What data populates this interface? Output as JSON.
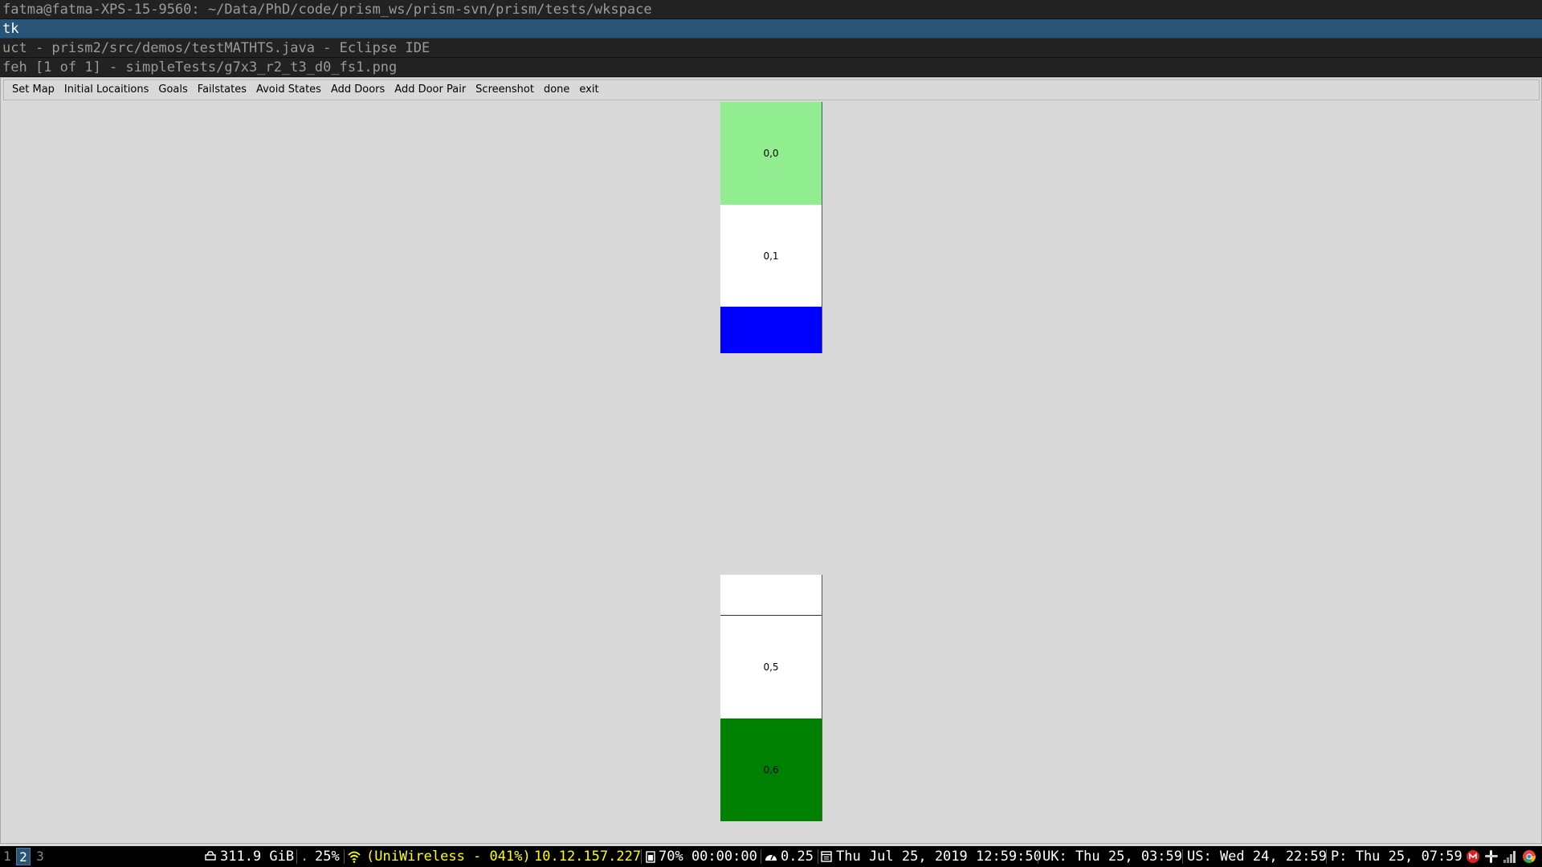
{
  "windows": {
    "title1": "fatma@fatma-XPS-15-9560: ~/Data/PhD/code/prism_ws/prism-svn/prism/tests/wkspace",
    "title2": "tk",
    "title3": "uct - prism2/src/demos/testMATHTS.java - Eclipse IDE",
    "title4": "feh [1 of 1] - simpleTests/g7x3_r2_t3_d0_fs1.png"
  },
  "menu": {
    "set_map": "Set Map",
    "initial_locations": "Initial Locaitions",
    "goals": "Goals",
    "failstates": "Failstates",
    "avoid_states": "Avoid States",
    "add_doors": "Add Doors",
    "add_door_pair": "Add Door Pair",
    "screenshot": "Screenshot",
    "done": "done",
    "exit": "exit"
  },
  "grid": {
    "cells": [
      {
        "label": "0,0",
        "color": "#90ee90"
      },
      {
        "label": "0,1",
        "color": "#ffffff"
      },
      {
        "label": "",
        "color": "#0000ff"
      },
      {
        "label": "",
        "color": "#ffffff"
      },
      {
        "label": "0,5",
        "color": "#ffffff"
      },
      {
        "label": "0,6",
        "color": "#008000"
      }
    ]
  },
  "statusbar": {
    "workspaces": [
      "1",
      "2",
      "3"
    ],
    "active_workspace": "2",
    "disk": "311.9 GiB",
    "volume": "25%",
    "wifi": "(UniWireless - 041%)",
    "ip": "10.12.157.227",
    "battery": "70% 00:00:00",
    "load": "0.25",
    "date": "Thu Jul 25, 2019 12:59:50",
    "uk_time": "UK: Thu 25, 03:59",
    "us_time": "US: Wed 24, 22:59",
    "p_time": "P: Thu 25, 07:59",
    "wifi_color": "#ffff00",
    "accent": "#285577"
  }
}
